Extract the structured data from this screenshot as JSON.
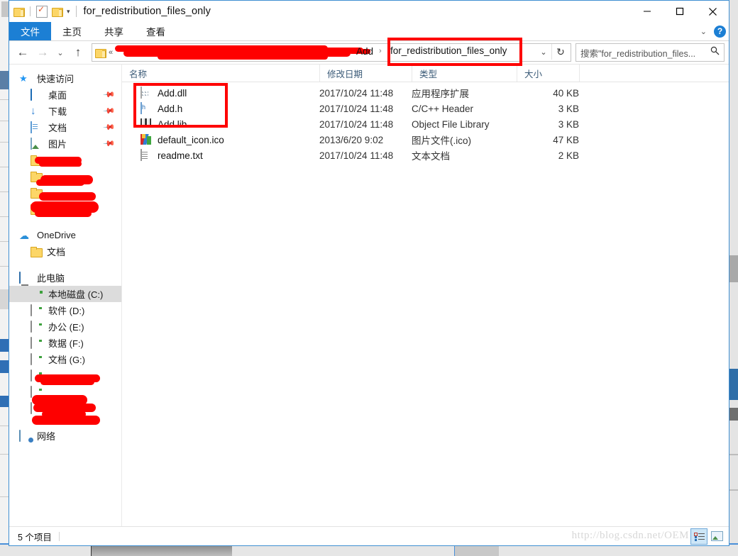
{
  "window": {
    "title": "for_redistribution_files_only",
    "controls": {
      "minimize": "─",
      "maximize": "□",
      "close": "✕"
    },
    "quick_access": {
      "folder_icon": "folder-icon",
      "properties_icon": "properties-icon",
      "new_folder_icon": "new-folder-icon",
      "customize_caret": "▾"
    }
  },
  "ribbon": {
    "tabs": [
      {
        "label": "文件",
        "active": true
      },
      {
        "label": "主页",
        "active": false
      },
      {
        "label": "共享",
        "active": false
      },
      {
        "label": "查看",
        "active": false
      }
    ],
    "expand_caret": "⌄",
    "help_label": "?"
  },
  "navbar": {
    "back": "←",
    "forward": "→",
    "recent": "⌄",
    "up": "↑",
    "address": {
      "folder_icon": "folder-icon",
      "overflow_chevron": "«",
      "redacted_path": "",
      "crumb": "Add",
      "crumb_separator": "›",
      "current_folder": "for_redistribution_files_only",
      "dropdown": "⌄",
      "refresh": "↻",
      "highlight_color": "#fe0000"
    },
    "search": {
      "placeholder": "搜索\"for_redistribution_files...",
      "icon": "search-icon"
    }
  },
  "nav_pane": {
    "groups": [
      {
        "name": "quick-access",
        "header": {
          "label": "快速访问",
          "icon": "star-pin-icon"
        },
        "items": [
          {
            "label": "桌面",
            "icon": "desktop-icon",
            "pinned": true,
            "redacted": false
          },
          {
            "label": "下载",
            "icon": "download-icon",
            "pinned": true,
            "redacted": false
          },
          {
            "label": "文档",
            "icon": "documents-icon",
            "pinned": true,
            "redacted": false
          },
          {
            "label": "图片",
            "icon": "pictures-icon",
            "pinned": true,
            "redacted": false
          },
          {
            "label": "",
            "icon": "folder-icon",
            "pinned": false,
            "redacted": true
          },
          {
            "label": "",
            "icon": "folder-icon",
            "pinned": false,
            "redacted": true
          },
          {
            "label": "",
            "icon": "folder-icon",
            "pinned": false,
            "redacted": true
          },
          {
            "label": "",
            "icon": "folder-icon",
            "pinned": false,
            "redacted": true
          }
        ]
      },
      {
        "name": "onedrive",
        "header": {
          "label": "OneDrive",
          "icon": "onedrive-icon"
        },
        "items": [
          {
            "label": "文档",
            "icon": "folder-icon",
            "pinned": false,
            "redacted": false
          }
        ]
      },
      {
        "name": "this-pc",
        "header": {
          "label": "此电脑",
          "icon": "this-pc-icon"
        },
        "items": [
          {
            "label": "本地磁盘 (C:)",
            "icon": "system-drive-icon",
            "pinned": false,
            "redacted": false,
            "selected": true
          },
          {
            "label": "软件 (D:)",
            "icon": "drive-icon",
            "pinned": false,
            "redacted": false
          },
          {
            "label": "办公 (E:)",
            "icon": "drive-icon",
            "pinned": false,
            "redacted": false
          },
          {
            "label": "数据 (F:)",
            "icon": "drive-icon",
            "pinned": false,
            "redacted": false
          },
          {
            "label": "文档 (G:)",
            "icon": "drive-icon",
            "pinned": false,
            "redacted": false
          },
          {
            "label": "",
            "icon": "drive-icon",
            "pinned": false,
            "redacted": true
          },
          {
            "label": "",
            "icon": "drive-icon",
            "pinned": false,
            "redacted": true
          },
          {
            "label": "",
            "icon": "drive-icon",
            "pinned": false,
            "redacted": true
          }
        ]
      },
      {
        "name": "network",
        "header": {
          "label": "网络",
          "icon": "network-icon"
        },
        "items": []
      }
    ]
  },
  "file_list": {
    "columns": [
      {
        "key": "name",
        "label": "名称",
        "sort_indicator": "⌃"
      },
      {
        "key": "date",
        "label": "修改日期",
        "sort_indicator": ""
      },
      {
        "key": "type",
        "label": "类型",
        "sort_indicator": ""
      },
      {
        "key": "size",
        "label": "大小",
        "sort_indicator": ""
      }
    ],
    "rows": [
      {
        "name": "Add.dll",
        "date": "2017/10/24 11:48",
        "type": "应用程序扩展",
        "size": "40 KB",
        "icon": "dll-file-icon"
      },
      {
        "name": "Add.h",
        "date": "2017/10/24 11:48",
        "type": "C/C++ Header",
        "size": "3 KB",
        "icon": "header-file-icon"
      },
      {
        "name": "Add.lib",
        "date": "2017/10/24 11:48",
        "type": "Object File Library",
        "size": "3 KB",
        "icon": "lib-file-icon"
      },
      {
        "name": "default_icon.ico",
        "date": "2013/6/20 9:02",
        "type": "图片文件(.ico)",
        "size": "47 KB",
        "icon": "ico-file-icon"
      },
      {
        "name": "readme.txt",
        "date": "2017/10/24 11:48",
        "type": "文本文档",
        "size": "2 KB",
        "icon": "text-file-icon"
      }
    ],
    "highlight_color": "#fe0000"
  },
  "status_bar": {
    "item_count": "5 个项目",
    "watermark": "http://blog.csdn.net/OEM",
    "view_buttons": [
      {
        "name": "details-view-button",
        "active": true
      },
      {
        "name": "tiles-view-button",
        "active": false
      }
    ]
  }
}
